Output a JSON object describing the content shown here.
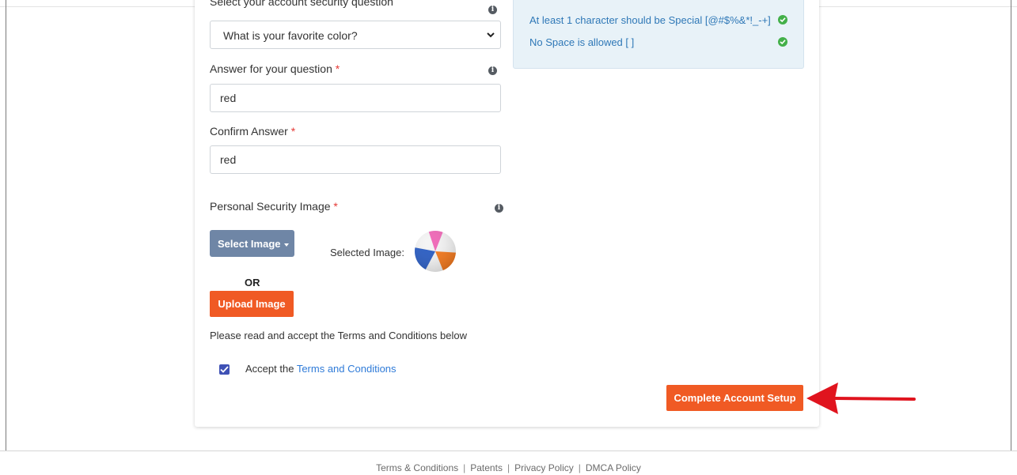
{
  "form": {
    "security_question_label": "Select your account security question",
    "security_question_value": "What is your favorite color?",
    "answer_label": "Answer for your question",
    "answer_value": "red",
    "confirm_label": "Confirm Answer",
    "confirm_value": "red",
    "required_mark": "*",
    "image_label": "Personal Security Image",
    "select_image_button": "Select Image",
    "selected_image_label": "Selected Image:",
    "or_text": "OR",
    "upload_button": "Upload Image",
    "terms_notice": "Please read and accept the Terms and Conditions below",
    "accept_prefix": "Accept the ",
    "terms_link": "Terms and Conditions",
    "accept_checked": true,
    "submit_button": "Complete Account Setup"
  },
  "password_rules": [
    {
      "text": "At least 1 character should be Special [@#$%&*!_-+]",
      "status": "ok"
    },
    {
      "text": "No Space is allowed [ ]",
      "status": "ok"
    }
  ],
  "footer": {
    "links": [
      "Terms & Conditions",
      "Patents",
      "Privacy Policy",
      "DMCA Policy"
    ],
    "separator": "|"
  },
  "colors": {
    "accent": "#f05a24",
    "secondary_button": "#6f86a6",
    "link": "#2f7bd8",
    "success": "#43b049",
    "required": "#e53935",
    "annotation_arrow": "#e0141e"
  },
  "icons": [
    "info-icon",
    "chevron-down-icon",
    "check-circle-icon",
    "caret-down-icon",
    "checkbox-check-icon",
    "beach-ball-image",
    "red-arrow-annotation"
  ]
}
